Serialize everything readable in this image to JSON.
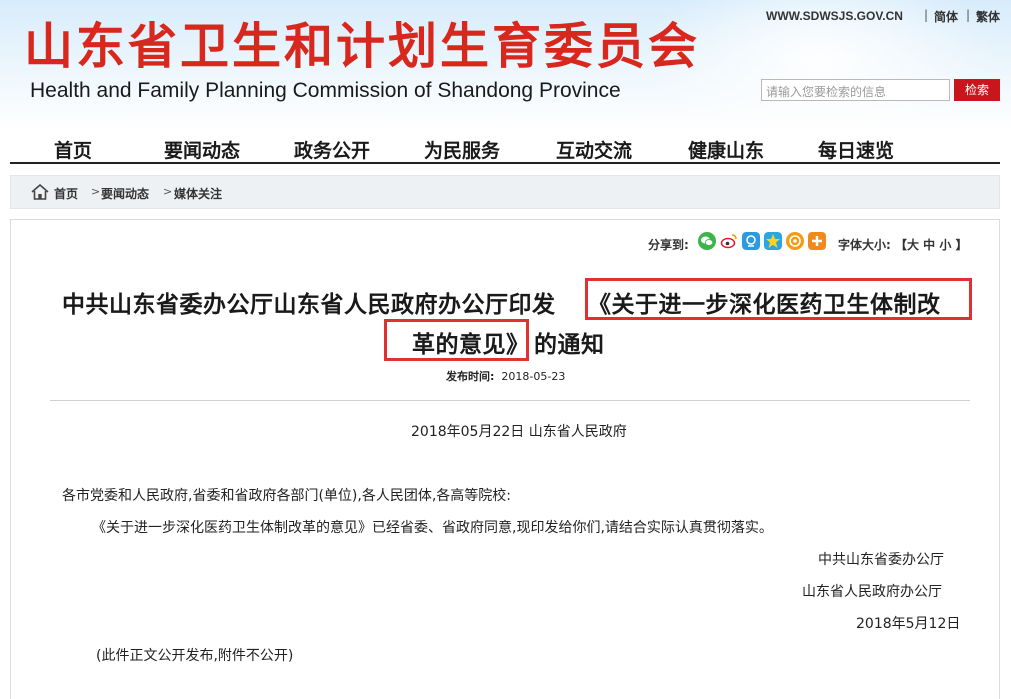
{
  "header": {
    "cn_title": "山东省卫生和计划生育委员会",
    "en_title": "Health and Family Planning Commission of Shandong Province",
    "site_url": "WWW.SDWSJS.GOV.CN",
    "lang_simplified": "简体",
    "lang_traditional": "繁体",
    "search_placeholder": "请输入您要检索的信息",
    "search_button": "检索"
  },
  "nav": {
    "items": [
      "首页",
      "要闻动态",
      "政务公开",
      "为民服务",
      "互动交流",
      "健康山东",
      "每日速览"
    ]
  },
  "breadcrumb": {
    "items": [
      "首页",
      "要闻动态",
      "媒体关注"
    ],
    "separator": ">"
  },
  "share": {
    "label": "分享到:",
    "font_size_label": "字体大小: 【大 中 小 】"
  },
  "article": {
    "title_line1_prefix": "中共山东省委办公厅山东省人民政府办公厅印发",
    "title_line1_highlight": "《关于进一步深化医药卫生体制改",
    "title_line2_highlight": "革的意见》",
    "title_line2_suffix": "的通知",
    "publish_label": "发布时间:",
    "publish_date": "2018-05-23",
    "source_line": "2018年05月22日  山东省人民政府",
    "salutation": "各市党委和人民政府,省委和省政府各部门(单位),各人民团体,各高等院校:",
    "body": "《关于进一步深化医药卫生体制改革的意见》已经省委、省政府同意,现印发给你们,请结合实际认真贯彻落实。",
    "signature1": "中共山东省委办公厅",
    "signature2": "山东省人民政府办公厅",
    "sign_date": "2018年5月12日",
    "note": "(此件正文公开发布,附件不公开)"
  },
  "colors": {
    "title_red": "#d8281e",
    "search_button_bg": "#c8161d",
    "highlight_border": "#e03131"
  },
  "icons": [
    "wechat-icon",
    "weibo-icon",
    "qzone-icon",
    "qq-star-icon",
    "renren-icon",
    "more-share-icon"
  ]
}
